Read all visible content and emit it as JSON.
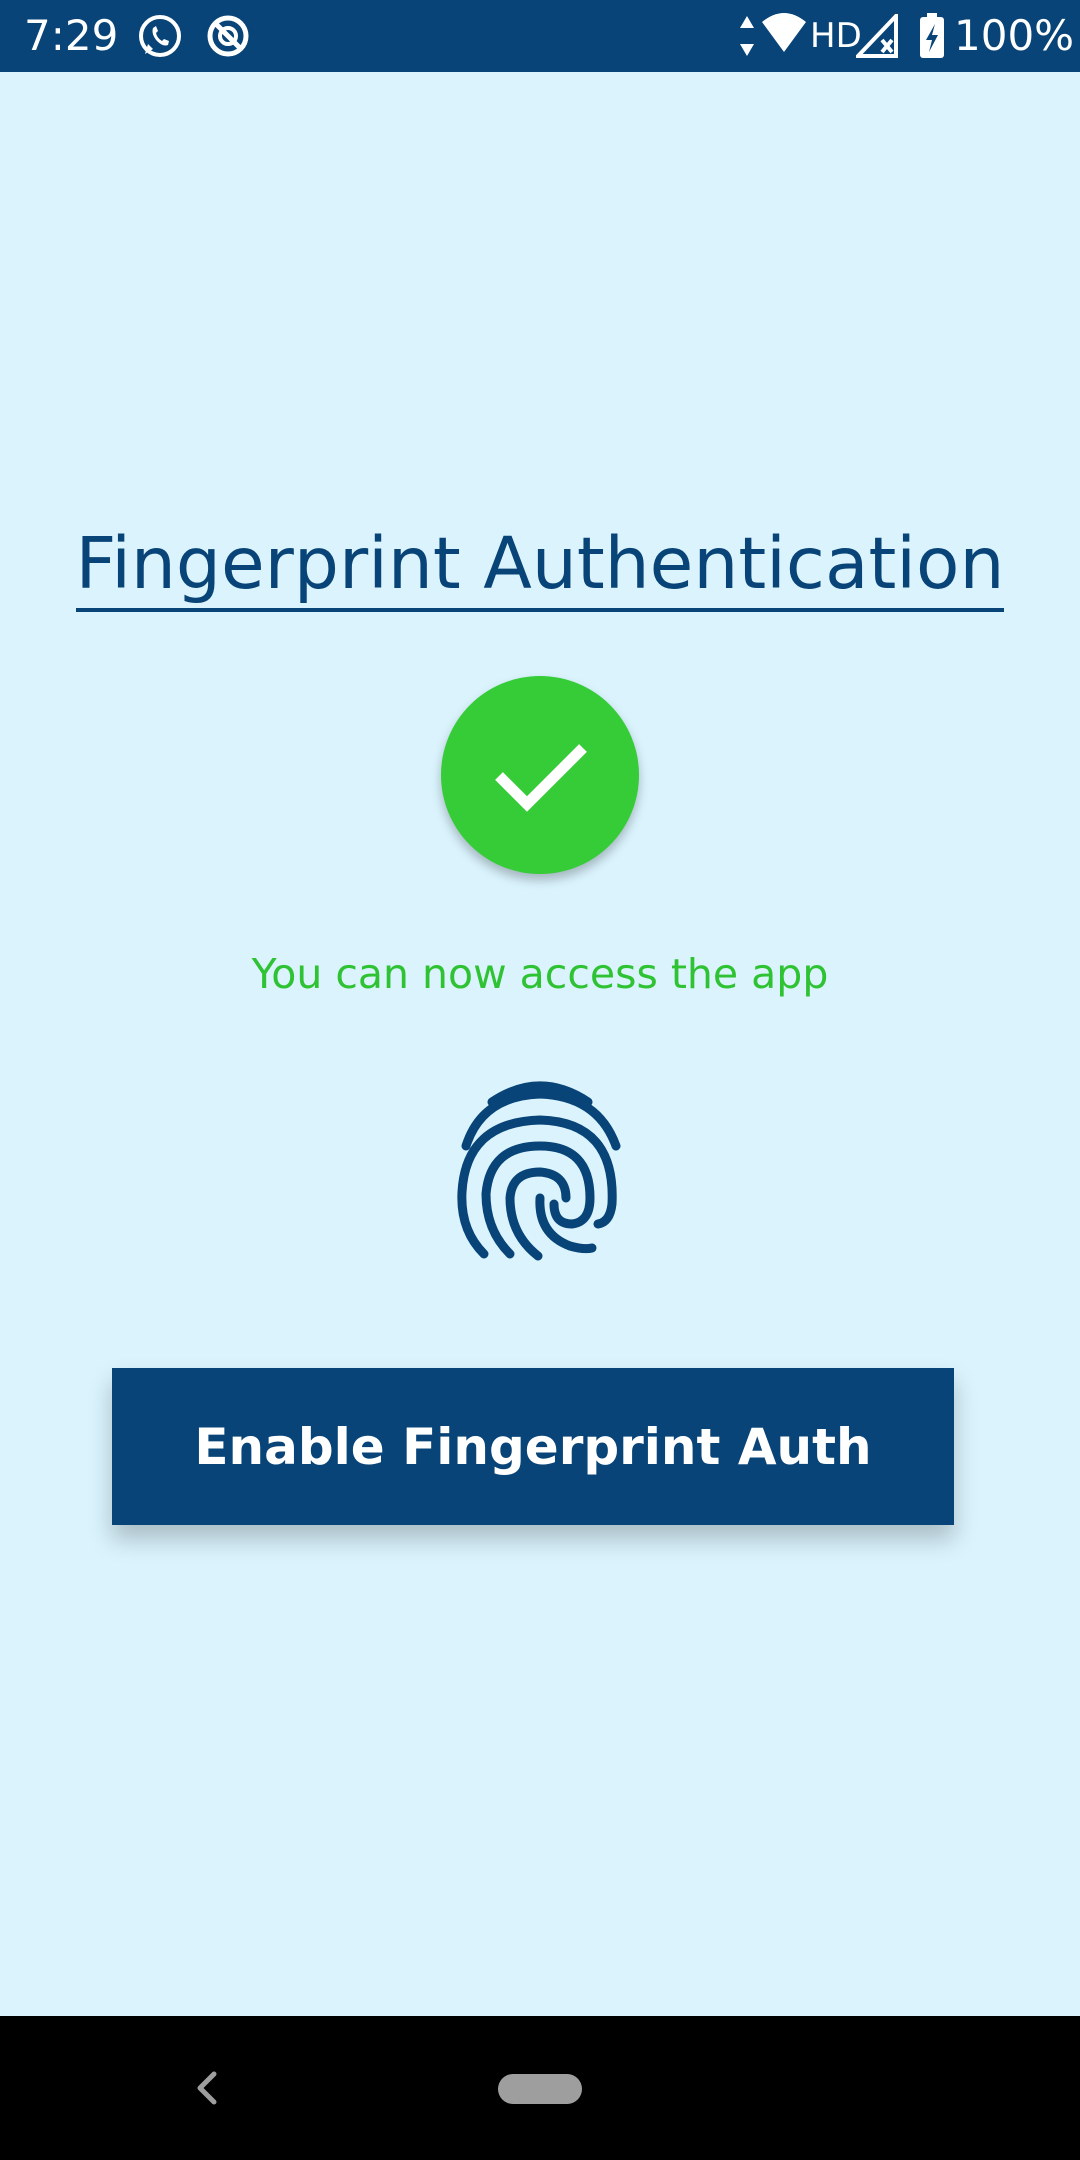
{
  "status_bar": {
    "time": "7:29",
    "network_label": "HD",
    "battery_percent": "100%",
    "icons": [
      "whatsapp-icon",
      "sync-icon",
      "data-arrows-icon",
      "wifi-icon",
      "signal-icon",
      "battery-charging-icon"
    ]
  },
  "main": {
    "title": "Fingerprint Authentication",
    "success_message": "You can now access the app",
    "success_icon": "checkmark-icon",
    "fingerprint_icon": "fingerprint-icon",
    "enable_button_label": "Enable Fingerprint Auth"
  },
  "nav_bar": {
    "icons": [
      "back-icon",
      "home-pill"
    ]
  },
  "colors": {
    "background": "#daf3fd",
    "primary": "#084477",
    "success": "#35cc37",
    "success_text": "#2fc333"
  }
}
